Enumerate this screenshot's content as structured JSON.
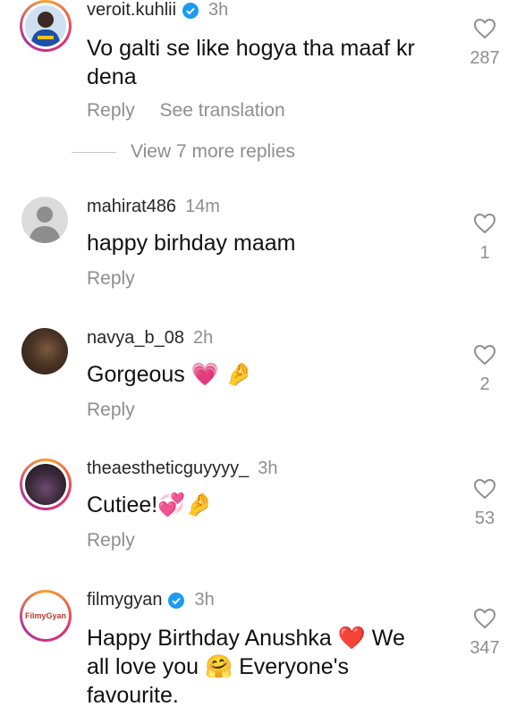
{
  "comments": [
    {
      "username": "veroit.kuhlii",
      "time": "3h",
      "verified": true,
      "text_lines": [
        "Vo galti se like hogya tha maaf kr",
        "dena"
      ],
      "actions": [
        "Reply",
        "See translation"
      ],
      "likes": "287"
    },
    {
      "username": "mahirat486",
      "time": "14m",
      "text_lines": [
        "happy birhday maam"
      ],
      "actions": [
        "Reply"
      ],
      "likes": "1"
    },
    {
      "username": "navya_b_08",
      "time": "2h",
      "text_lines": [
        "Gorgeous 💗 🤌"
      ],
      "actions": [
        "Reply"
      ],
      "likes": "2"
    },
    {
      "username": "theaestheticguyyyy_",
      "time": "3h",
      "text_lines": [
        "Cutiee!💞🤌"
      ],
      "actions": [
        "Reply"
      ],
      "likes": "53"
    },
    {
      "username": "filmygyan",
      "time": "3h",
      "verified": true,
      "avatar_logo": "FilmyGyan",
      "text_lines": [
        "Happy Birthday Anushka ❤️ We",
        "all love you 🤗 Everyone's",
        "favourite."
      ],
      "likes": "347"
    }
  ],
  "view_more": "View 7 more replies",
  "icons": {
    "like": "heart-outline-icon",
    "verified": "verified-badge-icon"
  },
  "colors": {
    "verified": "#1d9bf0",
    "meta_gray": "#8e8e8e"
  }
}
